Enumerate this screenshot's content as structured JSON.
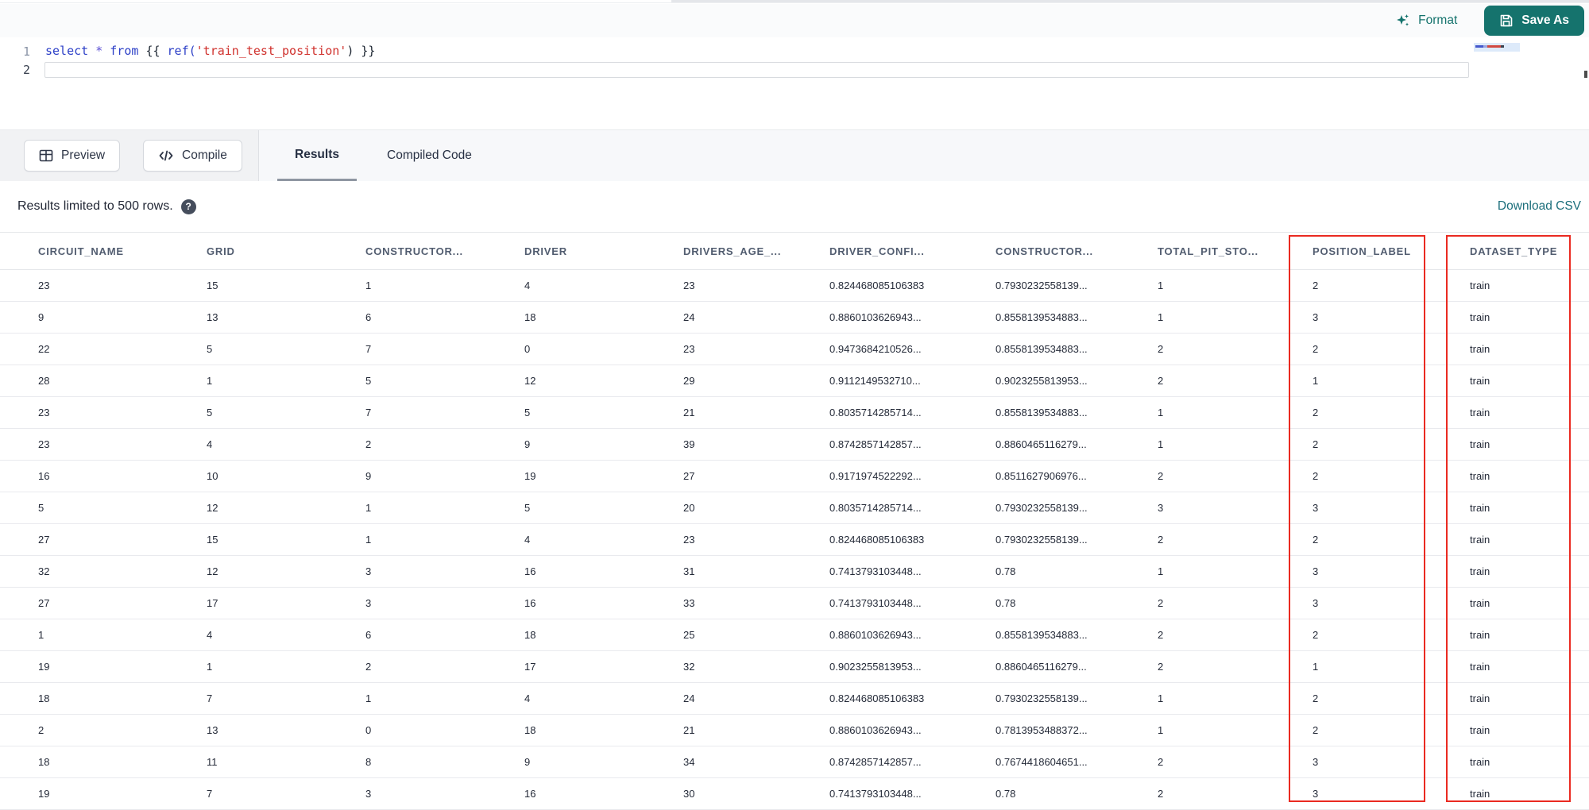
{
  "toolbar": {
    "format_label": "Format",
    "save_as_label": "Save As"
  },
  "editor": {
    "line_numbers": {
      "line1": "1",
      "line2": "2"
    },
    "code_full": "select * from {{ ref('train_test_position') }}",
    "tokens": [
      {
        "text": "select ",
        "type": "keyword"
      },
      {
        "text": "* ",
        "type": "operator"
      },
      {
        "text": "from ",
        "type": "keyword"
      },
      {
        "text": "{{ ",
        "type": "brace"
      },
      {
        "text": "ref(",
        "type": "function"
      },
      {
        "text": "'train_test_position'",
        "type": "string"
      },
      {
        "text": ") }}",
        "type": "brace"
      }
    ]
  },
  "actions": {
    "preview_label": "Preview",
    "compile_label": "Compile"
  },
  "tabs": [
    {
      "label": "Results",
      "active": true
    },
    {
      "label": "Compiled Code",
      "active": false
    }
  ],
  "results": {
    "limit_note": "Results limited to 500 rows.",
    "help_glyph": "?",
    "download_csv_label": "Download CSV"
  },
  "table": {
    "columns": [
      "CIRCUIT_NAME",
      "GRID",
      "CONSTRUCTOR...",
      "DRIVER",
      "DRIVERS_AGE_...",
      "DRIVER_CONFI...",
      "CONSTRUCTOR...",
      "TOTAL_PIT_STO...",
      "POSITION_LABEL",
      "DATASET_TYPE"
    ],
    "highlighted_columns": [
      "POSITION_LABEL",
      "DATASET_TYPE"
    ],
    "rows": [
      [
        "23",
        "15",
        "1",
        "4",
        "23",
        "0.824468085106383",
        "0.7930232558139...",
        "1",
        "2",
        "train"
      ],
      [
        "9",
        "13",
        "6",
        "18",
        "24",
        "0.8860103626943...",
        "0.8558139534883...",
        "1",
        "3",
        "train"
      ],
      [
        "22",
        "5",
        "7",
        "0",
        "23",
        "0.9473684210526...",
        "0.8558139534883...",
        "2",
        "2",
        "train"
      ],
      [
        "28",
        "1",
        "5",
        "12",
        "29",
        "0.9112149532710...",
        "0.9023255813953...",
        "2",
        "1",
        "train"
      ],
      [
        "23",
        "5",
        "7",
        "5",
        "21",
        "0.8035714285714...",
        "0.8558139534883...",
        "1",
        "2",
        "train"
      ],
      [
        "23",
        "4",
        "2",
        "9",
        "39",
        "0.8742857142857...",
        "0.8860465116279...",
        "1",
        "2",
        "train"
      ],
      [
        "16",
        "10",
        "9",
        "19",
        "27",
        "0.9171974522292...",
        "0.8511627906976...",
        "2",
        "2",
        "train"
      ],
      [
        "5",
        "12",
        "1",
        "5",
        "20",
        "0.8035714285714...",
        "0.7930232558139...",
        "3",
        "3",
        "train"
      ],
      [
        "27",
        "15",
        "1",
        "4",
        "23",
        "0.824468085106383",
        "0.7930232558139...",
        "2",
        "2",
        "train"
      ],
      [
        "32",
        "12",
        "3",
        "16",
        "31",
        "0.7413793103448...",
        "0.78",
        "1",
        "3",
        "train"
      ],
      [
        "27",
        "17",
        "3",
        "16",
        "33",
        "0.7413793103448...",
        "0.78",
        "2",
        "3",
        "train"
      ],
      [
        "1",
        "4",
        "6",
        "18",
        "25",
        "0.8860103626943...",
        "0.8558139534883...",
        "2",
        "2",
        "train"
      ],
      [
        "19",
        "1",
        "2",
        "17",
        "32",
        "0.9023255813953...",
        "0.8860465116279...",
        "2",
        "1",
        "train"
      ],
      [
        "18",
        "7",
        "1",
        "4",
        "24",
        "0.824468085106383",
        "0.7930232558139...",
        "1",
        "2",
        "train"
      ],
      [
        "2",
        "13",
        "0",
        "18",
        "21",
        "0.8860103626943...",
        "0.7813953488372...",
        "1",
        "2",
        "train"
      ],
      [
        "18",
        "11",
        "8",
        "9",
        "34",
        "0.8742857142857...",
        "0.7674418604651...",
        "2",
        "3",
        "train"
      ],
      [
        "19",
        "7",
        "3",
        "16",
        "30",
        "0.7413793103448...",
        "0.78",
        "2",
        "3",
        "train"
      ]
    ]
  },
  "colors": {
    "brand_teal": "#15736d",
    "link_teal": "#1b6e7b",
    "annotation_red": "#ea2a21",
    "keyword_blue": "#2c3fc7",
    "string_red": "#d0312d"
  }
}
